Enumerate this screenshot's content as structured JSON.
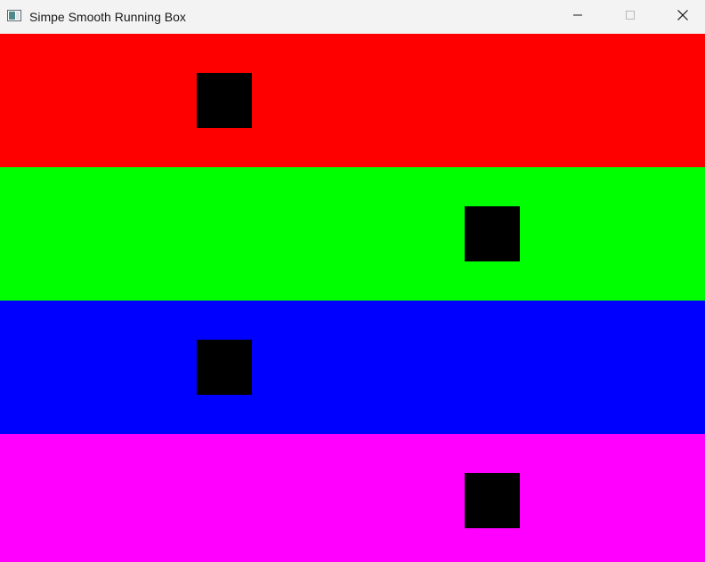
{
  "window": {
    "title": "Simpe Smooth Running Box",
    "app_icon": "window-app-icon",
    "controls": {
      "minimize_icon": "minimize-icon",
      "maximize_icon": "maximize-icon",
      "close_icon": "close-icon"
    }
  },
  "bands": [
    {
      "name": "red-band",
      "color": "#ff0000",
      "box_color": "#000000"
    },
    {
      "name": "green-band",
      "color": "#00ff00",
      "box_color": "#000000"
    },
    {
      "name": "blue-band",
      "color": "#0000ff",
      "box_color": "#000000"
    },
    {
      "name": "magenta-band",
      "color": "#ff00ff",
      "box_color": "#000000"
    }
  ],
  "colors": {
    "titlebar_bg": "#f3f3f3",
    "title_text": "#1a1a1a"
  }
}
